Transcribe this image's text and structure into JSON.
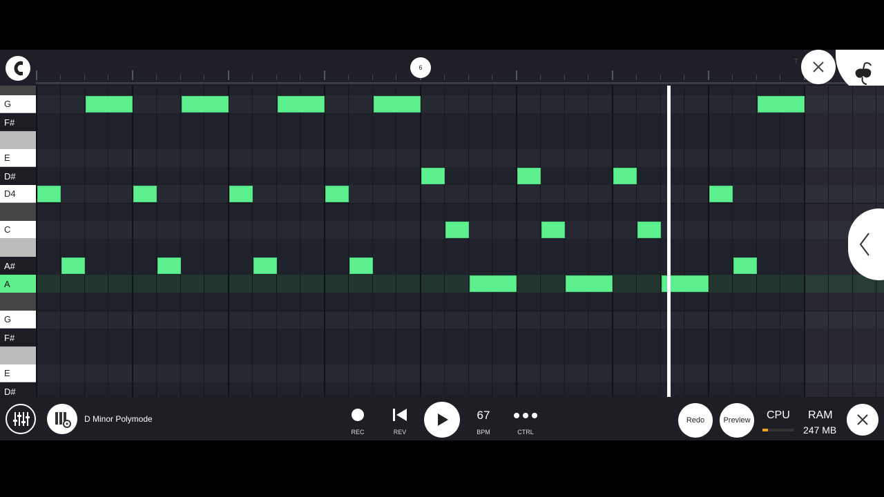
{
  "timeline": {
    "marker_6": "6",
    "marker_7": "7"
  },
  "keyboard": {
    "keys": [
      {
        "label": "",
        "kind": "dark"
      },
      {
        "label": "G",
        "kind": "white"
      },
      {
        "label": "F#",
        "kind": "black"
      },
      {
        "label": "",
        "kind": "gray"
      },
      {
        "label": "E",
        "kind": "white"
      },
      {
        "label": "D#",
        "kind": "black"
      },
      {
        "label": "D4",
        "kind": "white"
      },
      {
        "label": "",
        "kind": "dark"
      },
      {
        "label": "C",
        "kind": "white"
      },
      {
        "label": "",
        "kind": "gray"
      },
      {
        "label": "A#",
        "kind": "black"
      },
      {
        "label": "A",
        "kind": "active"
      },
      {
        "label": "",
        "kind": "dark"
      },
      {
        "label": "G",
        "kind": "white"
      },
      {
        "label": "F#",
        "kind": "black"
      },
      {
        "label": "",
        "kind": "gray"
      },
      {
        "label": "E",
        "kind": "white"
      },
      {
        "label": "D#",
        "kind": "black"
      }
    ]
  },
  "notes": [
    {
      "pitch": "D4",
      "start": 0,
      "length": 1
    },
    {
      "pitch": "D4",
      "start": 4,
      "length": 1
    },
    {
      "pitch": "D4",
      "start": 8,
      "length": 1
    },
    {
      "pitch": "D4",
      "start": 12,
      "length": 1
    },
    {
      "pitch": "D4",
      "start": 28,
      "length": 1
    },
    {
      "pitch": "D#",
      "start": 16,
      "length": 1
    },
    {
      "pitch": "D#",
      "start": 20,
      "length": 1
    },
    {
      "pitch": "D#",
      "start": 24,
      "length": 1
    },
    {
      "pitch": "C",
      "start": 17,
      "length": 1
    },
    {
      "pitch": "C",
      "start": 21,
      "length": 1
    },
    {
      "pitch": "C",
      "start": 25,
      "length": 1
    },
    {
      "pitch": "A#",
      "start": 1,
      "length": 1
    },
    {
      "pitch": "A#",
      "start": 5,
      "length": 1
    },
    {
      "pitch": "A#",
      "start": 9,
      "length": 1
    },
    {
      "pitch": "A#",
      "start": 13,
      "length": 1
    },
    {
      "pitch": "A#",
      "start": 29,
      "length": 1
    },
    {
      "pitch": "A",
      "start": 18,
      "length": 2
    },
    {
      "pitch": "A",
      "start": 22,
      "length": 2
    },
    {
      "pitch": "A",
      "start": 26,
      "length": 2
    },
    {
      "pitch": "G",
      "start": 2,
      "length": 2
    },
    {
      "pitch": "G",
      "start": 6,
      "length": 2
    },
    {
      "pitch": "G",
      "start": 10,
      "length": 2
    },
    {
      "pitch": "G",
      "start": 14,
      "length": 2
    },
    {
      "pitch": "G",
      "start": 30,
      "length": 2
    }
  ],
  "colors": {
    "note": "#5cf08f",
    "accent": "#f0a020"
  },
  "toolbar": {
    "project_name": "D Minor Polymode",
    "rec_label": "REC",
    "rev_label": "REV",
    "bpm_value": "67",
    "bpm_label": "BPM",
    "ctrl_label": "CTRL",
    "redo_label": "Redo",
    "preview_label": "Preview",
    "cpu_label": "CPU",
    "ram_label": "RAM",
    "ram_value": "247 MB"
  }
}
